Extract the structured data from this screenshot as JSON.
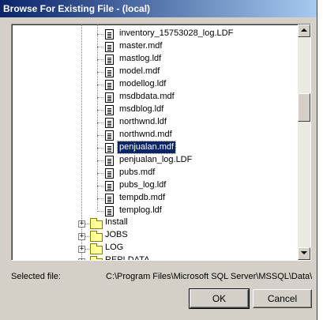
{
  "window": {
    "title": "Browse For Existing File - (local)"
  },
  "tree": {
    "files": [
      {
        "name": "inventory_15753028_log.LDF",
        "selected": false
      },
      {
        "name": "master.mdf",
        "selected": false
      },
      {
        "name": "mastlog.ldf",
        "selected": false
      },
      {
        "name": "model.mdf",
        "selected": false
      },
      {
        "name": "modellog.ldf",
        "selected": false
      },
      {
        "name": "msdbdata.mdf",
        "selected": false
      },
      {
        "name": "msdblog.ldf",
        "selected": false
      },
      {
        "name": "northwnd.ldf",
        "selected": false
      },
      {
        "name": "northwnd.mdf",
        "selected": false
      },
      {
        "name": "penjualan.mdf",
        "selected": true
      },
      {
        "name": "penjualan_log.LDF",
        "selected": false
      },
      {
        "name": "pubs.mdf",
        "selected": false
      },
      {
        "name": "pubs_log.ldf",
        "selected": false
      },
      {
        "name": "tempdb.mdf",
        "selected": false
      },
      {
        "name": "templog.ldf",
        "selected": false
      }
    ],
    "folders": [
      {
        "name": "Install",
        "expander": "+"
      },
      {
        "name": "JOBS",
        "expander": "+"
      },
      {
        "name": "LOG",
        "expander": "+"
      },
      {
        "name": "REPLDATA",
        "expander": "+"
      }
    ]
  },
  "footer": {
    "selected_file_label": "Selected file:",
    "selected_file_path": "C:\\Program Files\\Microsoft SQL Server\\MSSQL\\Data\\penjualan.mdf"
  },
  "buttons": {
    "ok": "OK",
    "cancel": "Cancel"
  }
}
